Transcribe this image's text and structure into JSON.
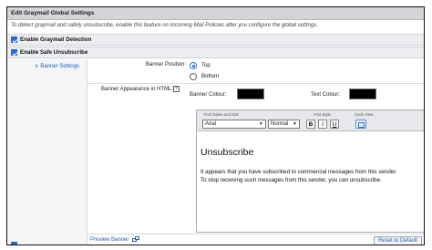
{
  "window": {
    "title": "Edit Graymail Global Settings",
    "intro": "To detect graymail and safely unsubscribe, enable this feature on Incoming Mail Policies after you configure the global settings."
  },
  "options": {
    "detection_label": "Enable Graymail Detection",
    "detection_checked": true,
    "unsubscribe_label": "Enable Safe Unsubscribe",
    "unsubscribe_checked": true
  },
  "banner": {
    "section_label": "Banner Settings",
    "position_label": "Banner Position:",
    "position_options": [
      "Top",
      "Bottom"
    ],
    "position_selected": "Top",
    "appearance_label": "Banner Appearance in HTML:",
    "help_glyph": "?",
    "banner_colour_label": "Banner Colour:",
    "banner_colour": "#000000",
    "text_colour_label": "Text Colour:",
    "text_colour": "#000000"
  },
  "editor": {
    "font_group_caption": "Font Name and Size",
    "style_group_caption": "Font Style",
    "code_group_caption": "Code View",
    "font_name": "Arial",
    "font_size": "Normal",
    "bold": "B",
    "italic": "I",
    "underline": "U",
    "heading": "Unsubscribe",
    "body_line1": "It appears that you have subscribed to commercial messages from this sender.",
    "body_line2": "To stop receiving such messages from this sender, you can unsubscribe."
  },
  "footer": {
    "preview_label": "Preview Banner",
    "reset_label": "Reset to Default"
  },
  "colors": {
    "accent": "#2b6fd6",
    "link": "#2a5db0",
    "title_bar": "#d3d5d8"
  }
}
